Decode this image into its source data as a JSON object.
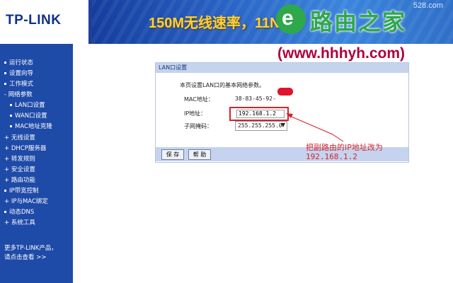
{
  "header": {
    "logo": "TP-LINK",
    "banner_text": "150M无线速率，11N",
    "banner_site": "528.com"
  },
  "watermark": {
    "icon_letter": "e",
    "title": "路由之家",
    "url": "(www.hhhyh.com)"
  },
  "sidebar": {
    "items": [
      {
        "label": "运行状态"
      },
      {
        "label": "设置向导"
      },
      {
        "label": "工作模式"
      },
      {
        "label": "网络参数"
      },
      {
        "label": "LAN口设置"
      },
      {
        "label": "WAN口设置"
      },
      {
        "label": "MAC地址克隆"
      },
      {
        "label": "无线设置"
      },
      {
        "label": "DHCP服务器"
      },
      {
        "label": "转发规则"
      },
      {
        "label": "安全设置"
      },
      {
        "label": "路由功能"
      },
      {
        "label": "IP带宽控制"
      },
      {
        "label": "IP与MAC绑定"
      },
      {
        "label": "动态DNS"
      },
      {
        "label": "系统工具"
      }
    ],
    "more_line1": "更多TP-LINK产品，",
    "more_line2": "请点击查看 >>"
  },
  "panel": {
    "title": "LAN口设置",
    "description": "本页设置LAN口的基本网络参数。",
    "mac_label": "MAC地址：",
    "mac_value": "38-83-45-92-",
    "ip_label": "IP地址：",
    "ip_value": "192.168.1.2",
    "mask_label": "子网掩码：",
    "mask_value": "255.255.255.0",
    "save_label": "保 存",
    "help_label": "帮 助"
  },
  "annotation": {
    "line1": "把副路由的IP地址改为",
    "line2": "192.168.1.2",
    "color": "#d1242a"
  }
}
